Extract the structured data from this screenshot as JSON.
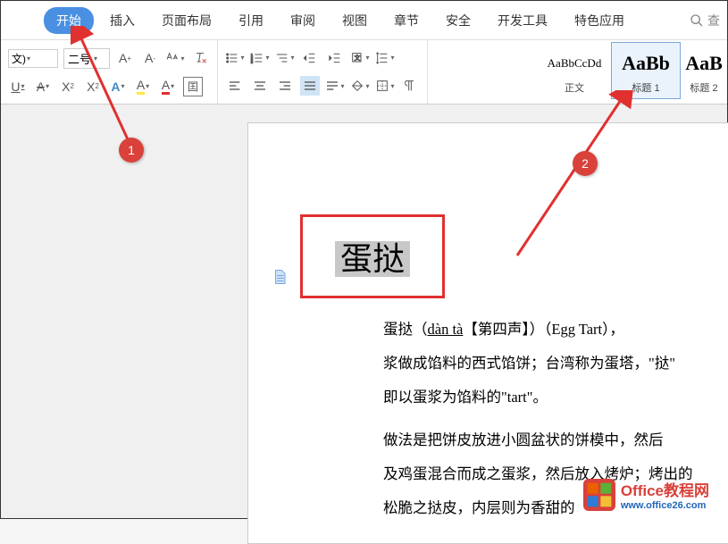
{
  "tabs": {
    "t0": "开始",
    "t1": "插入",
    "t2": "页面布局",
    "t3": "引用",
    "t4": "审阅",
    "t5": "视图",
    "t6": "章节",
    "t7": "安全",
    "t8": "开发工具",
    "t9": "特色应用"
  },
  "search": {
    "placeholder": "查"
  },
  "toolbar": {
    "context_label": "文)",
    "font_size": "二号",
    "font_color_letter": "A",
    "highlight_letter": "A",
    "outline_letter": "A",
    "wen_char": "囯"
  },
  "styles": {
    "s1_preview": "AaBbCcDd",
    "s1_label": "正文",
    "s2_preview": "AaBb",
    "s2_label": "标题 1",
    "s3_preview": "AaB",
    "s3_label": "标题 2"
  },
  "annotations": {
    "badge1": "1",
    "badge2": "2"
  },
  "document": {
    "title": "蛋挞",
    "p1_pre": "蛋挞（",
    "p1_pinyin": "dàn tà",
    "p1_post": "【第四声】）（Egg Tart），",
    "p2": "浆做成馅料的西式馅饼；台湾称为蛋塔，\"挞\"",
    "p3": "即以蛋浆为馅料的\"tart\"。",
    "p4": "做法是把饼皮放进小圆盆状的饼模中，然后",
    "p5": "及鸡蛋混合而成之蛋浆，然后放入烤炉；烤出的",
    "p6": "松脆之挞皮，内层则为香甜的"
  },
  "watermark": {
    "logo_top": "Office",
    "title": "Office教程网",
    "url": "www.office26.com"
  }
}
